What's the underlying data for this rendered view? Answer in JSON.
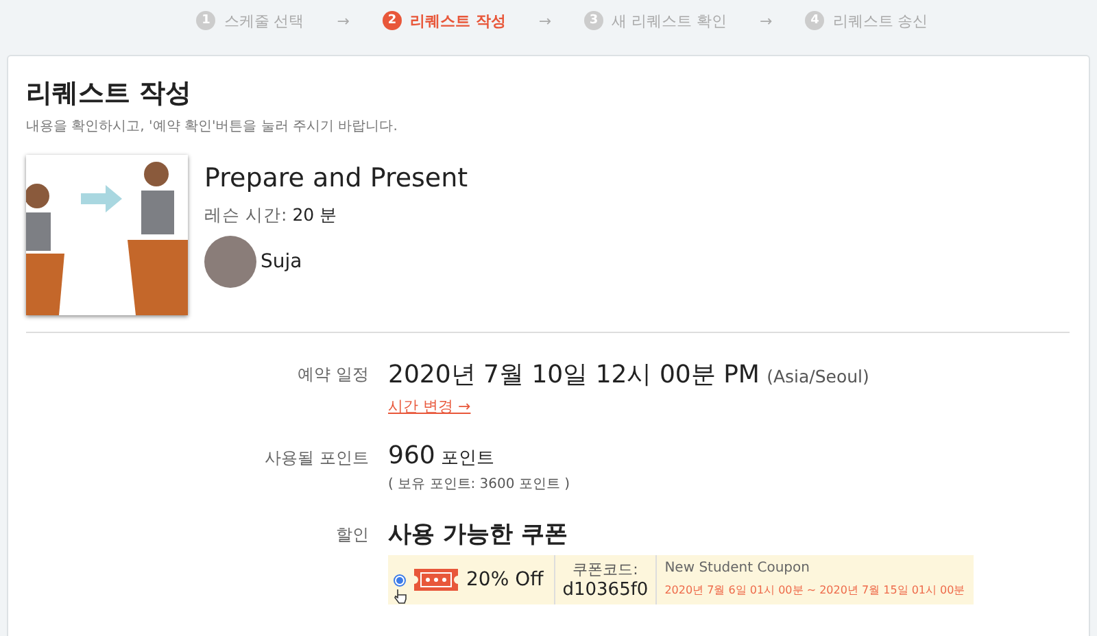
{
  "steps": [
    {
      "number": "1",
      "label": "스케줄 선택",
      "selected": false
    },
    {
      "number": "2",
      "label": "리퀘스트 작성",
      "selected": true
    },
    {
      "number": "3",
      "label": "새 리퀘스트 확인",
      "selected": false
    },
    {
      "number": "4",
      "label": "리퀘스트 송신",
      "selected": false
    }
  ],
  "step_arrow": "→",
  "card": {
    "title": "리퀘스트 작성",
    "subtitle": "내용을 확인하시고, '예약 확인'버튼을 눌러 주시기 바랍니다."
  },
  "lesson": {
    "title": "Prepare and Present",
    "duration_label": "레슨 시간:",
    "duration": "20 분",
    "tutor": "Suja"
  },
  "schedule": {
    "label": "예약 일정",
    "datetime": "2020년 7월 10일 12시 00분 PM",
    "timezone": "(Asia/Seoul)",
    "change_link": "시간 변경 →"
  },
  "points": {
    "label": "사용될 포인트",
    "amount": "960",
    "unit": "포인트",
    "balance": "( 보유 포인트: 3600 포인트 )"
  },
  "discount": {
    "label": "할인",
    "heading": "사용 가능한 쿠폰",
    "coupons": [
      {
        "selected": true,
        "discount": "20% Off",
        "code_label": "쿠폰코드:",
        "code": "d10365f0",
        "name": "New Student Coupon",
        "validity": "2020년 7월 6일 01시 00분 ~ 2020년 7월 15일 01시 00분"
      }
    ]
  }
}
